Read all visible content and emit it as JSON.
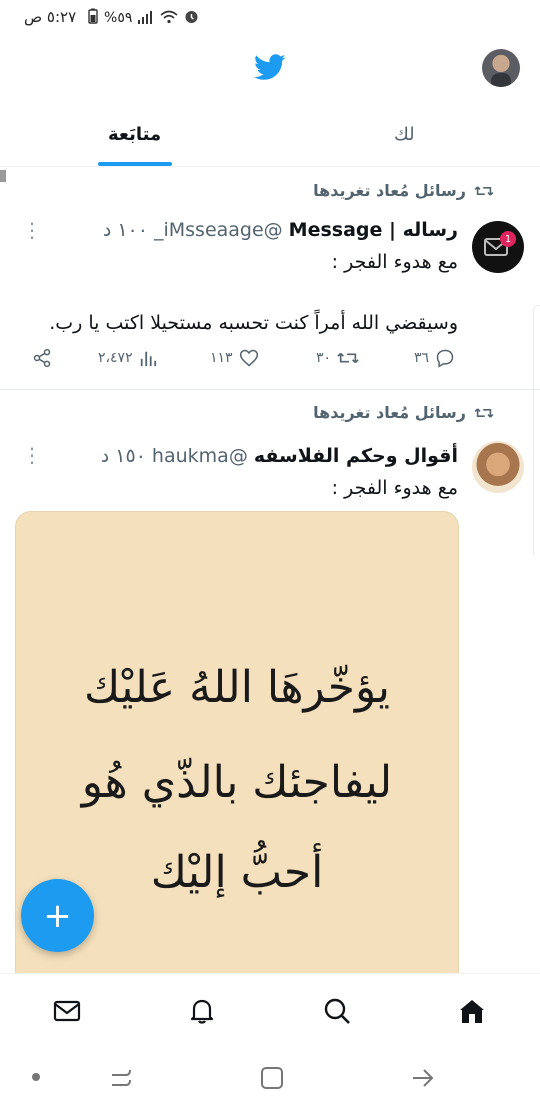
{
  "status_bar": {
    "time": "٥:٢٧ ص",
    "battery": "%٥٩"
  },
  "tabs": [
    {
      "label": "لك"
    },
    {
      "label": "متابَعة"
    }
  ],
  "tweets": [
    {
      "retweet_label": "رسائل مُعاد تغريدها",
      "name": "رساله | Message",
      "handle": "@iMsseaage_",
      "time": "١٠٠ د",
      "text_line1": "مع هدوء الفجر :",
      "text_line2": "وسيقضي الله أمراً كنت تحسبه مستحيلا اكتب يا رب.",
      "avatar_badge": "1",
      "replies": "٣٦",
      "retweets": "٣٠",
      "likes": "١١٣",
      "views": "٢،٤٧٢"
    },
    {
      "retweet_label": "رسائل مُعاد تغريدها",
      "name": "أقوال وحكم الفلاسفه",
      "handle": "@haukma",
      "time": "١٥٠ د",
      "text_line1": "مع هدوء الفجر :",
      "media_lines": [
        "يؤخّرهَا اللهُ عَليْك",
        "ليفاجئك بالذّي هُو",
        "أحبُّ إليْك"
      ]
    }
  ],
  "fab": {
    "label": "+"
  },
  "colors": {
    "accent": "#1d9bf0",
    "text": "#0f1419",
    "muted": "#536471",
    "badge": "#e0245e"
  },
  "icons": [
    "mail-icon",
    "bell-icon",
    "search-icon",
    "home-icon",
    "reply-icon",
    "retweet-icon",
    "like-icon",
    "views-icon",
    "share-icon",
    "twitter-bird-icon"
  ]
}
